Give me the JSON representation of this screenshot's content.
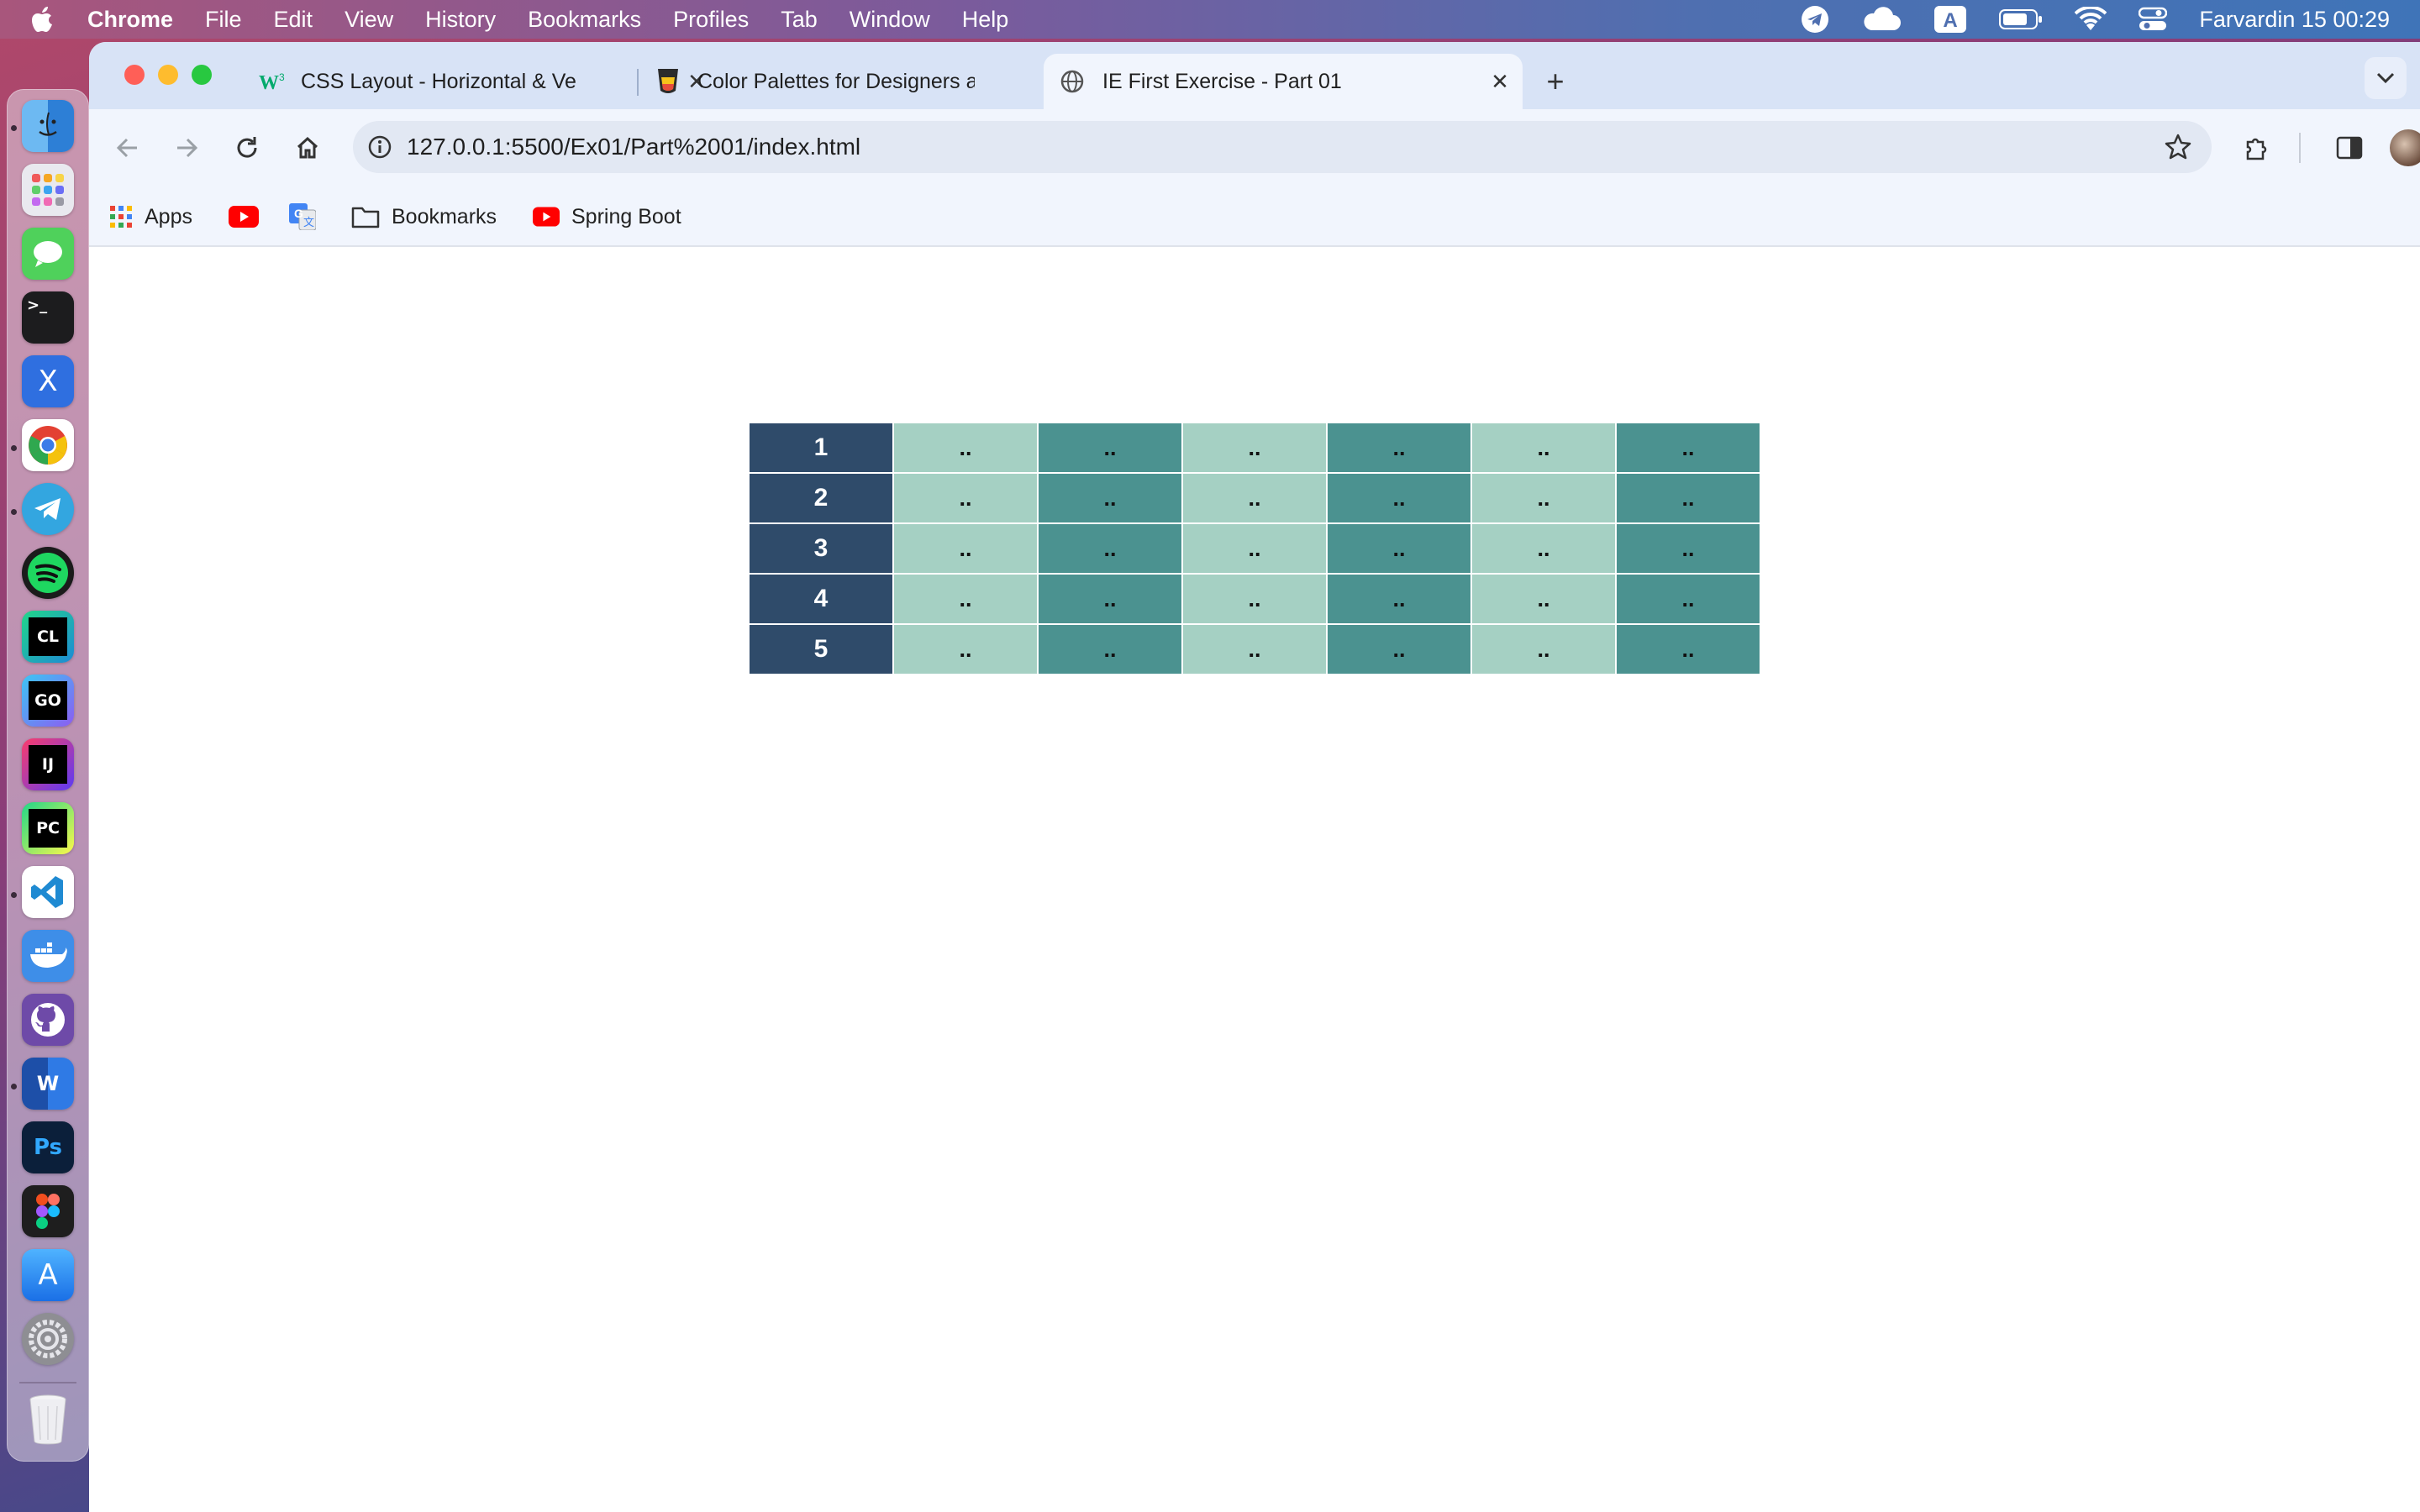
{
  "menubar": {
    "app_name": "Chrome",
    "items": [
      "File",
      "Edit",
      "View",
      "History",
      "Bookmarks",
      "Profiles",
      "Tab",
      "Window",
      "Help"
    ],
    "input_indicator": "A",
    "clock": "Farvardin 15  00:29"
  },
  "dock": {
    "apps": [
      {
        "name": "finder-icon",
        "label": ""
      },
      {
        "name": "launchpad-icon",
        "label": ""
      },
      {
        "name": "messages-icon",
        "label": ""
      },
      {
        "name": "terminal-icon",
        "label": ">_"
      },
      {
        "name": "x-icon",
        "label": "X"
      },
      {
        "name": "chrome-icon",
        "label": ""
      },
      {
        "name": "telegram-icon",
        "label": ""
      },
      {
        "name": "spotify-icon",
        "label": ""
      },
      {
        "name": "clion-icon",
        "label": "CL"
      },
      {
        "name": "goland-icon",
        "label": "GO"
      },
      {
        "name": "intellij-icon",
        "label": "IJ"
      },
      {
        "name": "pycharm-icon",
        "label": "PC"
      },
      {
        "name": "vscode-icon",
        "label": ""
      },
      {
        "name": "docker-icon",
        "label": ""
      },
      {
        "name": "github-icon",
        "label": ""
      },
      {
        "name": "word-icon",
        "label": "W"
      },
      {
        "name": "photoshop-icon",
        "label": "Ps"
      },
      {
        "name": "figma-icon",
        "label": ""
      },
      {
        "name": "appstore-icon",
        "label": "A"
      },
      {
        "name": "system-settings-icon",
        "label": ""
      },
      {
        "name": "trash-icon",
        "label": ""
      }
    ]
  },
  "browser": {
    "tabs": [
      {
        "title": "CSS Layout - Horizontal & Ve",
        "active": false
      },
      {
        "title": "Color Palettes for Designers a",
        "active": false
      },
      {
        "title": "IE First Exercise - Part 01",
        "active": true
      }
    ],
    "url": "127.0.0.1:5500/Ex01/Part%2001/index.html",
    "bookmarks": [
      {
        "label": "Apps"
      },
      {
        "label": ""
      },
      {
        "label": ""
      },
      {
        "label": "Bookmarks"
      },
      {
        "label": "Spring Boot"
      }
    ]
  },
  "table": {
    "rows": [
      {
        "head": "1",
        "cells": [
          "..",
          "..",
          "..",
          "..",
          "..",
          ".."
        ]
      },
      {
        "head": "2",
        "cells": [
          "..",
          "..",
          "..",
          "..",
          "..",
          ".."
        ]
      },
      {
        "head": "3",
        "cells": [
          "..",
          "..",
          "..",
          "..",
          "..",
          ".."
        ]
      },
      {
        "head": "4",
        "cells": [
          "..",
          "..",
          "..",
          "..",
          "..",
          ".."
        ]
      },
      {
        "head": "5",
        "cells": [
          "..",
          "..",
          "..",
          "..",
          "..",
          ".."
        ]
      }
    ],
    "colors": {
      "head": "#2f4b6a",
      "light": "#a5d0c3",
      "dark": "#4b9290"
    }
  }
}
